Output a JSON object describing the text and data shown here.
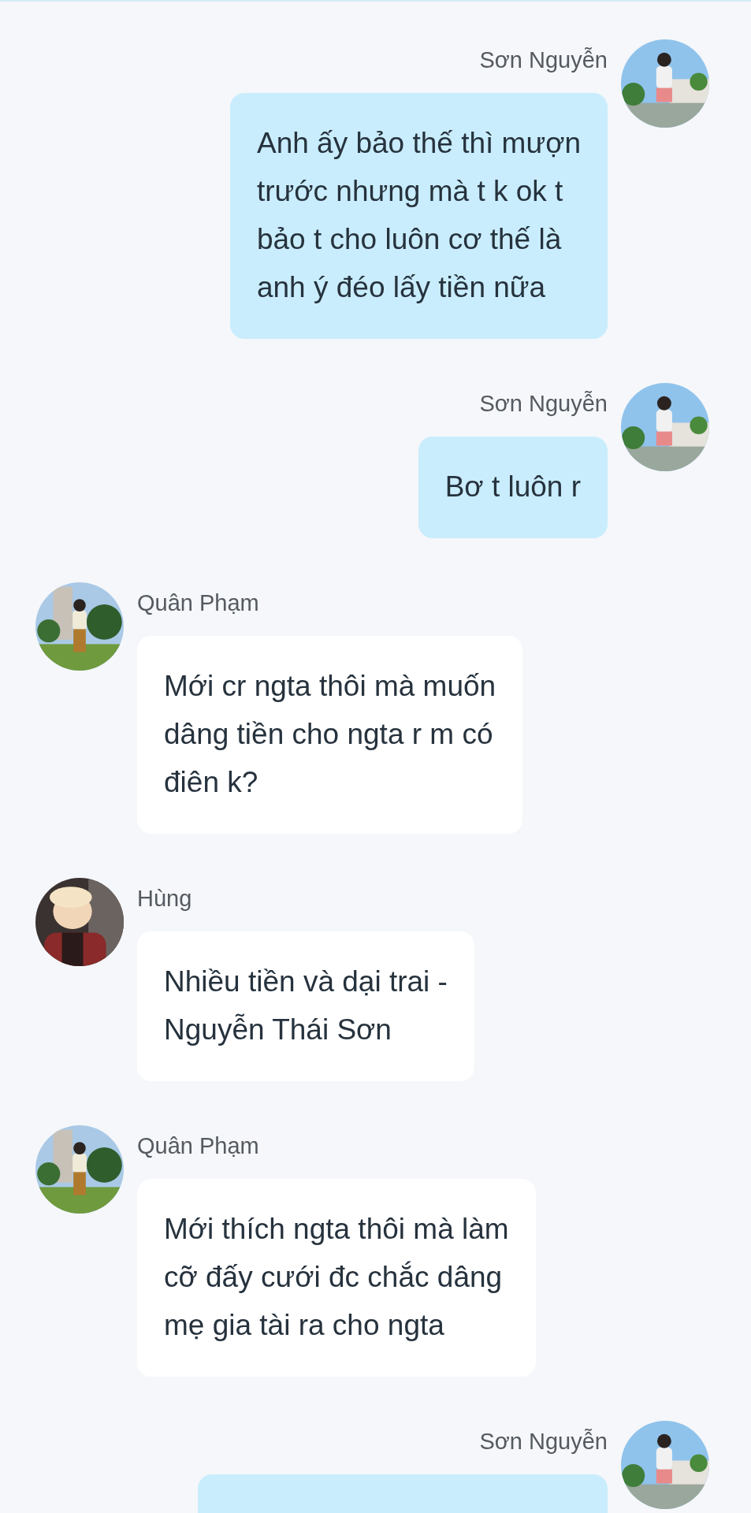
{
  "messages": [
    {
      "kind": "sent",
      "sender": "Sơn Nguyễn",
      "text": "Anh ấy bảo thế thì mượn\ntrước nhưng mà t k ok t\nbảo t cho luôn cơ thế là\nanh ý đéo lấy tiền nữa"
    },
    {
      "kind": "sent",
      "sender": "Sơn Nguyễn",
      "text": "Bơ t luôn r"
    },
    {
      "kind": "received",
      "sender": "Quân Phạm",
      "text": "Mới cr ngta thôi mà muốn\ndâng tiền cho ngta r m có\nđiên k?"
    },
    {
      "kind": "received",
      "sender": "Hùng",
      "text": "Nhiều tiền và dại trai -\nNguyễn Thái Sơn"
    },
    {
      "kind": "received",
      "sender": "Quân Phạm",
      "text": "Mới thích ngta thôi mà làm\ncỡ đấy cưới đc chắc dâng\nmẹ gia tài ra cho ngta"
    },
    {
      "kind": "sent",
      "sender": "Sơn Nguyễn"
    }
  ]
}
